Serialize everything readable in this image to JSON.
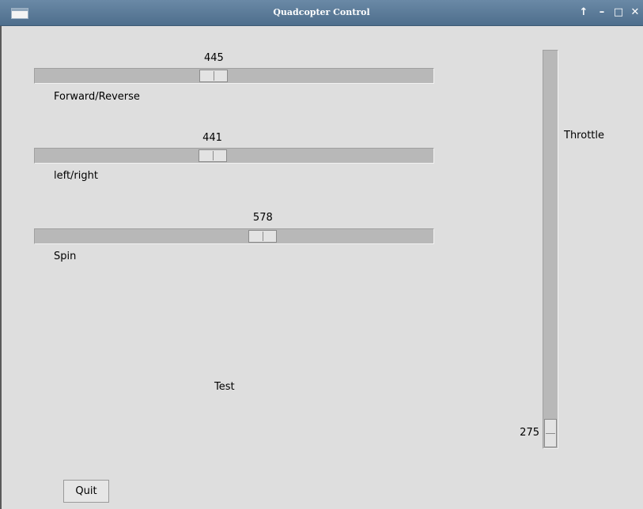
{
  "window": {
    "title": "Quadcopter Control",
    "controls": {
      "up": "↑",
      "minimize": "–",
      "maximize": "□",
      "close": "✕"
    }
  },
  "sliders": {
    "forward_reverse": {
      "label": "Forward/Reverse",
      "value": "445",
      "fraction": 0.445
    },
    "left_right": {
      "label": "left/right",
      "value": "441",
      "fraction": 0.441
    },
    "spin": {
      "label": "Spin",
      "value": "578",
      "fraction": 0.578
    }
  },
  "throttle": {
    "label": "Throttle",
    "value": "275",
    "fraction": 0.275
  },
  "test_label": "Test",
  "quit_label": "Quit",
  "colors": {
    "titlebar": "#5a7a98",
    "background": "#dedede",
    "trough": "#b8b8b8"
  }
}
